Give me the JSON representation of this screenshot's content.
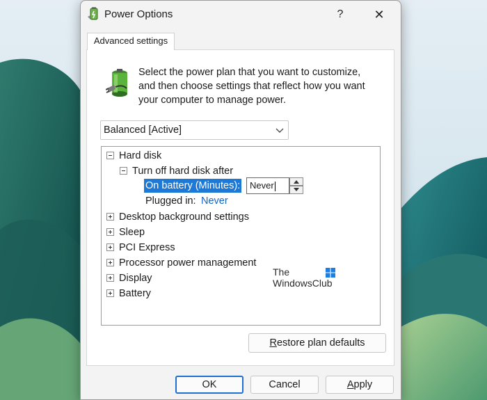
{
  "window": {
    "title": "Power Options",
    "help_glyph": "?",
    "close_glyph": "✕"
  },
  "tab": {
    "label": "Advanced settings"
  },
  "description": {
    "line1": "Select the power plan that you want to customize,",
    "line2": "and then choose settings that reflect how you want",
    "line3": "your computer to manage power."
  },
  "plan_select": {
    "value": "Balanced [Active]"
  },
  "tree": {
    "hard_disk": "Hard disk",
    "turn_off_after": "Turn off hard disk after",
    "on_battery_label": "On battery (Minutes):",
    "on_battery_value": "Never",
    "plugged_in_label": "Plugged in:",
    "plugged_in_value": "Never",
    "collapsed": [
      "Desktop background settings",
      "Sleep",
      "PCI Express",
      "Processor power management",
      "Display",
      "Battery"
    ]
  },
  "watermark": {
    "line1": "The",
    "line2": "WindowsClub"
  },
  "buttons": {
    "restore_prefix": "R",
    "restore_rest": "estore plan defaults",
    "ok": "OK",
    "cancel": "Cancel",
    "apply_prefix": "A",
    "apply_rest": "pply"
  },
  "colors": {
    "selection": "#1e78d6",
    "link_value": "#1565c0",
    "ok_border": "#1e6fd0"
  },
  "icons": [
    "power-options-icon",
    "battery-plug-icon",
    "chevron-down-icon",
    "spin-up-icon",
    "spin-down-icon",
    "windows-logo-icon"
  ]
}
